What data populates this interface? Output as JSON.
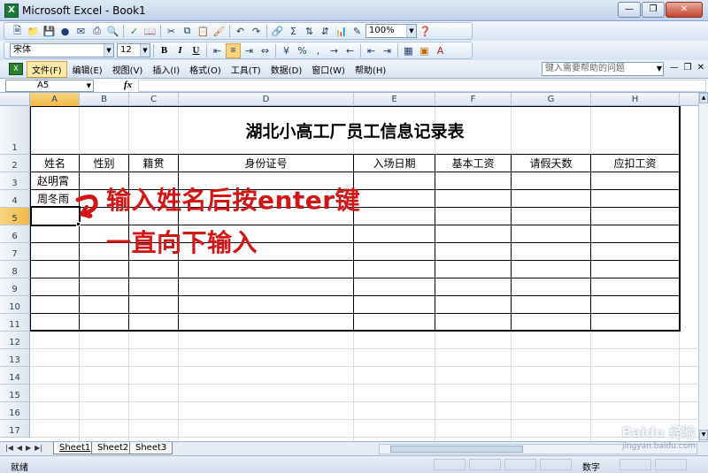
{
  "window": {
    "title": "Microsoft Excel - Book1"
  },
  "toolbar": {
    "zoom": "100%",
    "font_name": "宋体",
    "font_size": "12",
    "bold_label": "B",
    "italic_label": "I",
    "underline_label": "U"
  },
  "menu": {
    "items": [
      "文件(F)",
      "编辑(E)",
      "视图(V)",
      "插入(I)",
      "格式(O)",
      "工具(T)",
      "数据(D)",
      "窗口(W)",
      "帮助(H)"
    ],
    "help_placeholder": "键入需要帮助的问题"
  },
  "formula_bar": {
    "name_box": "A5",
    "fx_label": "fx",
    "content": ""
  },
  "columns": [
    "A",
    "B",
    "C",
    "D",
    "E",
    "F",
    "G",
    "H"
  ],
  "rows": [
    "1",
    "2",
    "3",
    "4",
    "5",
    "6",
    "7",
    "8",
    "9",
    "10",
    "11",
    "12",
    "13",
    "14",
    "15",
    "16",
    "17"
  ],
  "sheet": {
    "title": "湖北小高工厂员工信息记录表",
    "headers": [
      "姓名",
      "性别",
      "籍贯",
      "身份证号",
      "入场日期",
      "基本工资",
      "请假天数",
      "应扣工资"
    ],
    "names": [
      "赵明霄",
      "周冬雨"
    ],
    "active_cell": "A5"
  },
  "annotation": {
    "line1": "输入姓名后按enter键",
    "line2": "一直向下输入",
    "color": "#d21515"
  },
  "sheet_tabs": [
    "Sheet1",
    "Sheet2",
    "Sheet3"
  ],
  "status": {
    "left": "就绪",
    "mode": "数字"
  },
  "watermark": {
    "brand": "Baidu 经验",
    "url": "jingyan.baidu.com"
  },
  "colors": {
    "accent": "#f1b94a",
    "titlebar": "#bfd3ea"
  }
}
